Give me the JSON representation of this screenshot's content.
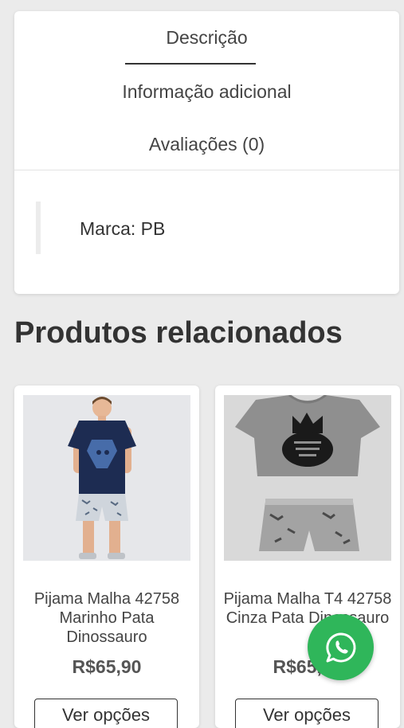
{
  "tabs": [
    {
      "label": "Descrição",
      "active": true
    },
    {
      "label": "Informação adicional",
      "active": false
    },
    {
      "label": "Avaliações (0)",
      "active": false
    }
  ],
  "description": {
    "brand_line": "Marca: PB"
  },
  "related": {
    "title": "Produtos relacionados",
    "products": [
      {
        "name": "Pijama Malha 42758 Marinho Pata Dinossauro",
        "price": "R$65,90",
        "button_label": "Ver opções"
      },
      {
        "name": "Pijama Malha T4 42758 Cinza Pata Dinossauro",
        "price": "R$65,90",
        "button_label": "Ver opções"
      }
    ]
  },
  "whatsapp": {
    "icon": "whatsapp-icon",
    "color": "#2fb65a"
  },
  "colors": {
    "background": "#ebebeb",
    "card": "#ffffff",
    "text": "#333333"
  }
}
